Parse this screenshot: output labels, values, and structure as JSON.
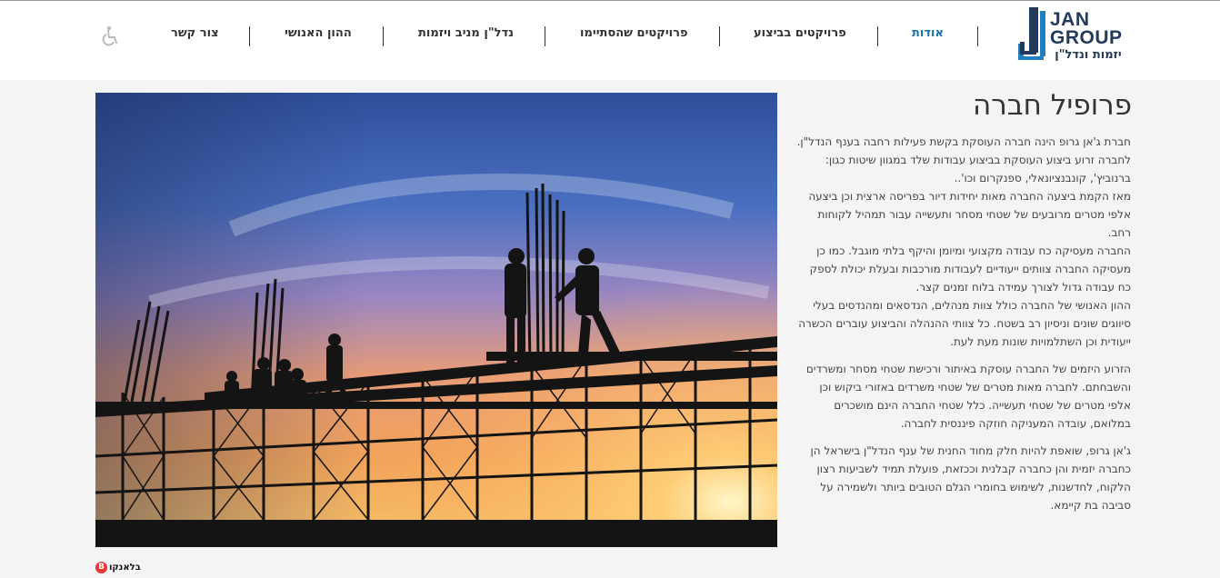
{
  "logo": {
    "line1": "JAN",
    "line2": "GROUP",
    "tagline": "יזמות ונדל\"ן",
    "colors": {
      "navy": "#233a5a",
      "blue": "#1f7fc0"
    }
  },
  "nav": {
    "items": [
      {
        "label": "אודות",
        "active": true
      },
      {
        "label": "פרויקטים בביצוע",
        "active": false
      },
      {
        "label": "פרויקטים שהסתיימו",
        "active": false
      },
      {
        "label": "נדל\"ן מניב ויזמות",
        "active": false
      },
      {
        "label": "ההון האנושי",
        "active": false
      },
      {
        "label": "צור קשר",
        "active": false
      }
    ],
    "accessibility_icon": "wheelchair-icon"
  },
  "hero": {
    "icon": "construction-silhouette-image"
  },
  "content": {
    "title": "פרופיל חברה",
    "paragraphs": [
      "חברת ג'אן גרופ הינה חברה העוסקת בקשת פעילות רחבה בענף הנדל\"ן.",
      "לחברה זרוע ביצוע העוסקת בביצוע עבודות שלד במגוון שיטות כגון: ברנוביץ', קונבנציונאלי, ספנקרום וכו'..",
      "מאז הקמת ביצעה החברה מאות יחידות דיור בפריסה ארצית וכן ביצעה אלפי מטרים מרובעים של שטחי מסחר ותעשייה עבור תמהיל לקוחות רחב.",
      "החברה מעסיקה כח עבודה מקצועי ומיומן והיקף בלתי מוגבל. כמו כן מעסיקה החברה צוותים ייעודיים לעבודות מורכבות ובעלת יכולת לספק כח עבודה גדול לצורך עמידה בלוח זמנים קצר.",
      "ההון האנושי של החברה כולל צוות מנהלים, הנדסאים ומהנדסים בעלי סיווגים שונים וניסיון רב בשטח. כל צוותי ההנהלה והביצוע עוברים הכשרה ייעודית וכן השתלמויות שונות מעת לעת.",
      "הזרוע היזמים של החברה עוסקת באיתור ורכישת שטחי מסחר ומשרדים והשבחתם. לחברה מאות מטרים של שטחי משרדים באזורי ביקוש וכן אלפי מטרים של שטחי תעשייה. כלל שטחי החברה הינם מושכרים במלואם, עובדה המעניקה חוזקה פיננסית לחברה.",
      "ג'אן גרופ, שואפת להיות חלק מחוד החנית של ענף הנדל\"ן בישראל הן כחברה יזמית והן כחברה קבלנית וככזאת, פועלת תמיד לשביעות רצון הלקוח, לחדשנות, לשימוש בחומרי הגלם הטובים ביותר ולשמירה על סביבה בת קיימא."
    ]
  },
  "credit": {
    "label": "בלאנקו",
    "badge": "B"
  }
}
